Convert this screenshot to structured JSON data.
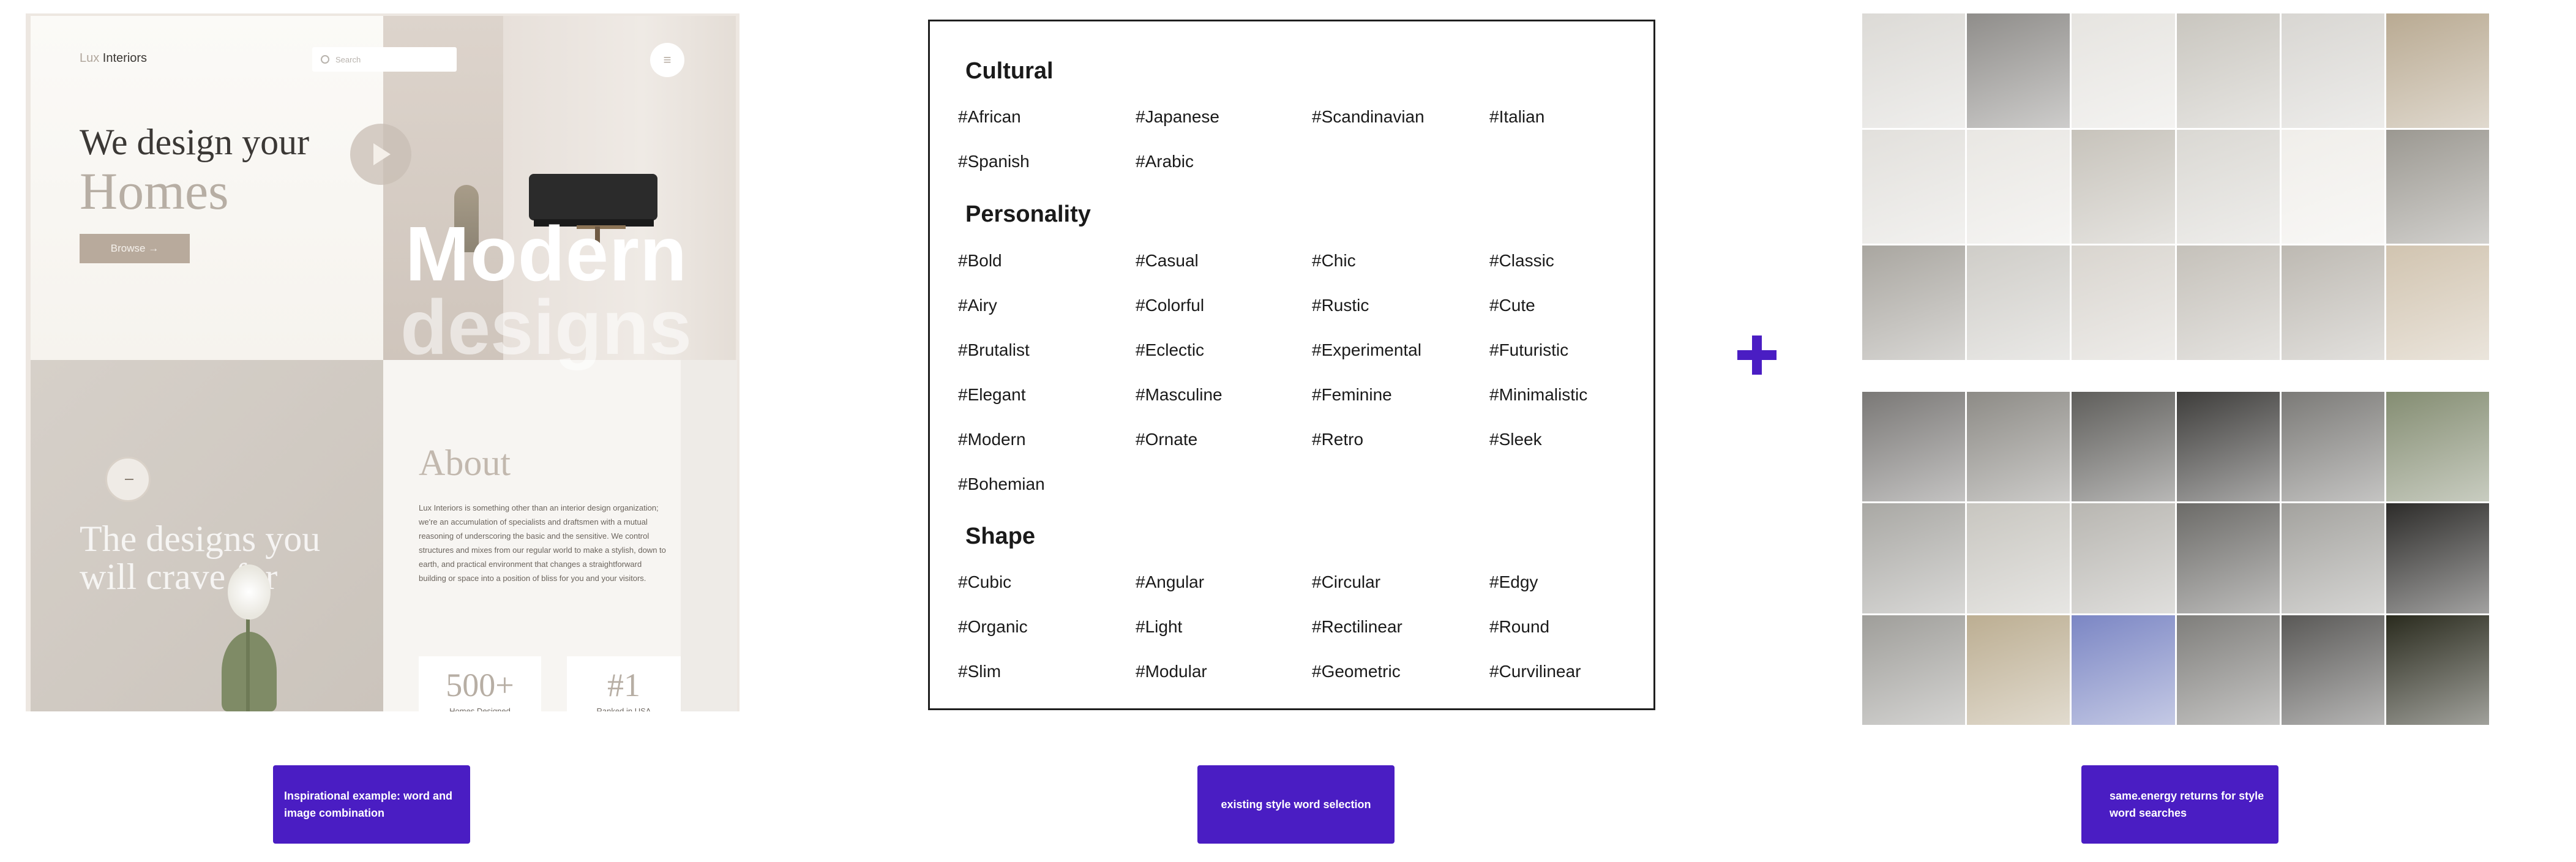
{
  "mockup": {
    "logo_light": "Lux",
    "logo_dark": " Interiors",
    "search_placeholder": "Search",
    "menu_icon": "≡",
    "hero_line1": "We design your",
    "hero_line2": "Homes",
    "browse_label": "Browse →",
    "modern": "Modern",
    "designs": "designs",
    "quote_line1": "The designs you",
    "quote_line2": "will crave for",
    "about_title": "About",
    "about_body": "Lux Interiors is something other than an interior design organization; we're an accumulation of specialists and draftsmen with a mutual reasoning of underscoring the basic and the sensitive. We control structures and mixes from our regular world to make a stylish, down to earth, and practical environment that changes a straightforward building or space into a position of bliss for you and your visitors.",
    "stats": [
      {
        "value": "500+",
        "label": "Homes Designed"
      },
      {
        "value": "#1",
        "label": "Ranked in USA"
      }
    ]
  },
  "style_words": {
    "categories": [
      {
        "title": "Cultural",
        "tags": [
          "#African",
          "#Japanese",
          "#Scandinavian",
          "#Italian",
          "#Spanish",
          "#Arabic"
        ]
      },
      {
        "title": "Personality",
        "tags": [
          "#Bold",
          "#Casual",
          "#Chic",
          "#Classic",
          "#Airy",
          "#Colorful",
          "#Rustic",
          "#Cute",
          "#Brutalist",
          "#Eclectic",
          "#Experimental",
          "#Futuristic",
          "#Elegant",
          "#Masculine",
          "#Feminine",
          "#Minimalistic",
          "#Modern",
          "#Ornate",
          "#Retro",
          "#Sleek",
          "#Bohemian"
        ]
      },
      {
        "title": "Shape",
        "tags": [
          "#Cubic",
          "#Angular",
          "#Circular",
          "#Edgy",
          "#Organic",
          "#Light",
          "#Rectilinear",
          "#Round",
          "#Slim",
          "#Modular",
          "#Geometric",
          "#Curvilinear"
        ]
      }
    ]
  },
  "captions": {
    "left": "Inspirational example: word and image combination",
    "middle": "existing style word selection",
    "right": "same.energy returns for style word searches"
  },
  "colors": {
    "accent": "#4a1dc3",
    "grid1": [
      "#dcdad6",
      "#8f8d8a",
      "#e6e4e0",
      "#c9c6bf",
      "#d8d6d2",
      "#b9aa92",
      "#e2e0dc",
      "#e9e7e3",
      "#c7c3bb",
      "#dad8d3",
      "#f0eeea",
      "#9b9891",
      "#a9a6a0",
      "#cfcdc8",
      "#d9d5cf",
      "#c5c1ba",
      "#bdb9b2",
      "#d1c4b0"
    ],
    "grid2": [
      "#7a7876",
      "#8d8b86",
      "#5f5e5b",
      "#3e3d3b",
      "#7b7a77",
      "#848d72",
      "#a9a8a4",
      "#c8c6c0",
      "#b8b6b1",
      "#6c6b68",
      "#a3a29e",
      "#2d2c2a",
      "#9f9e9a",
      "#bcae92",
      "#7b86c4",
      "#7f7e7b",
      "#5a5957",
      "#2a2b1e"
    ]
  }
}
